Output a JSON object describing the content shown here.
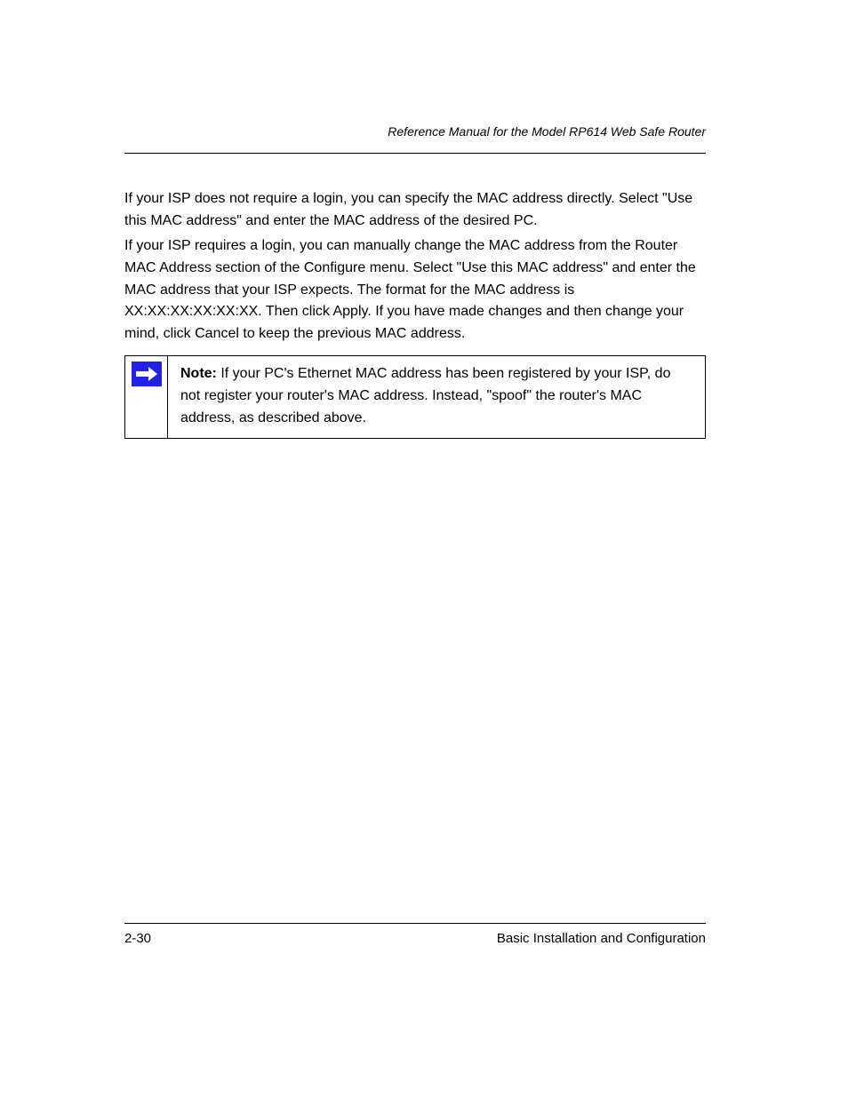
{
  "header": {
    "model_line": "Reference Manual for the Model RP614 Web Safe Router"
  },
  "content": {
    "para1": "If your ISP does not require a login, you can specify the MAC address directly. Select \"Use this MAC address\" and enter the MAC address of the desired PC.",
    "para2": "If your ISP requires a login, you can manually change the MAC address from the Router MAC Address section of the Configure menu. Select \"Use this MAC address\" and enter the MAC address that your ISP expects. The format for the MAC address is XX:XX:XX:XX:XX:XX. Then click Apply. If you have made changes and then change your mind, click Cancel to keep the previous MAC address."
  },
  "callout": {
    "label": "Note:",
    "text": " If your PC's Ethernet MAC address has been registered by your ISP, do not register your router's MAC address. Instead, \"spoof\" the router's MAC address, as described above."
  },
  "footer": {
    "page": "2-30",
    "chapter": "Basic Installation and Configuration"
  }
}
